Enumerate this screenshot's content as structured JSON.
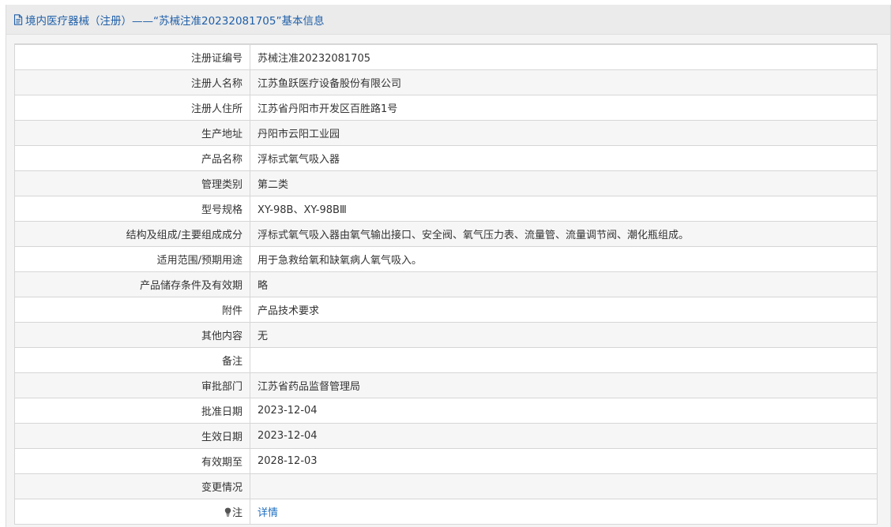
{
  "header": {
    "icon": "document-icon",
    "title": "境内医疗器械（注册）——“苏械注准20232081705”基本信息"
  },
  "rows": [
    {
      "label": "注册证编号",
      "value": "苏械注准20232081705"
    },
    {
      "label": "注册人名称",
      "value": "江苏鱼跃医疗设备股份有限公司"
    },
    {
      "label": "注册人住所",
      "value": "江苏省丹阳市开发区百胜路1号"
    },
    {
      "label": "生产地址",
      "value": "丹阳市云阳工业园"
    },
    {
      "label": "产品名称",
      "value": "浮标式氧气吸入器"
    },
    {
      "label": "管理类别",
      "value": "第二类"
    },
    {
      "label": "型号规格",
      "value": "XY-98B、XY-98BⅢ"
    },
    {
      "label": "结构及组成/主要组成成分",
      "value": "浮标式氧气吸入器由氧气输出接口、安全阀、氧气压力表、流量管、流量调节阀、潮化瓶组成。"
    },
    {
      "label": "适用范围/预期用途",
      "value": "用于急救给氧和缺氧病人氧气吸入。"
    },
    {
      "label": "产品储存条件及有效期",
      "value": "略"
    },
    {
      "label": "附件",
      "value": "产品技术要求"
    },
    {
      "label": "其他内容",
      "value": "无"
    },
    {
      "label": "备注",
      "value": ""
    },
    {
      "label": "审批部门",
      "value": "江苏省药品监督管理局"
    },
    {
      "label": "批准日期",
      "value": "2023-12-04"
    },
    {
      "label": "生效日期",
      "value": "2023-12-04"
    },
    {
      "label": "有效期至",
      "value": "2028-12-03"
    },
    {
      "label": "变更情况",
      "value": ""
    }
  ],
  "note_row": {
    "icon": "lightbulb-icon",
    "label": "注",
    "link_text": "详情"
  },
  "colors": {
    "title": "#1f5fa8",
    "link": "#1f6fc1",
    "border": "#d6d6d6",
    "row_alt": "#f6f6f6"
  }
}
